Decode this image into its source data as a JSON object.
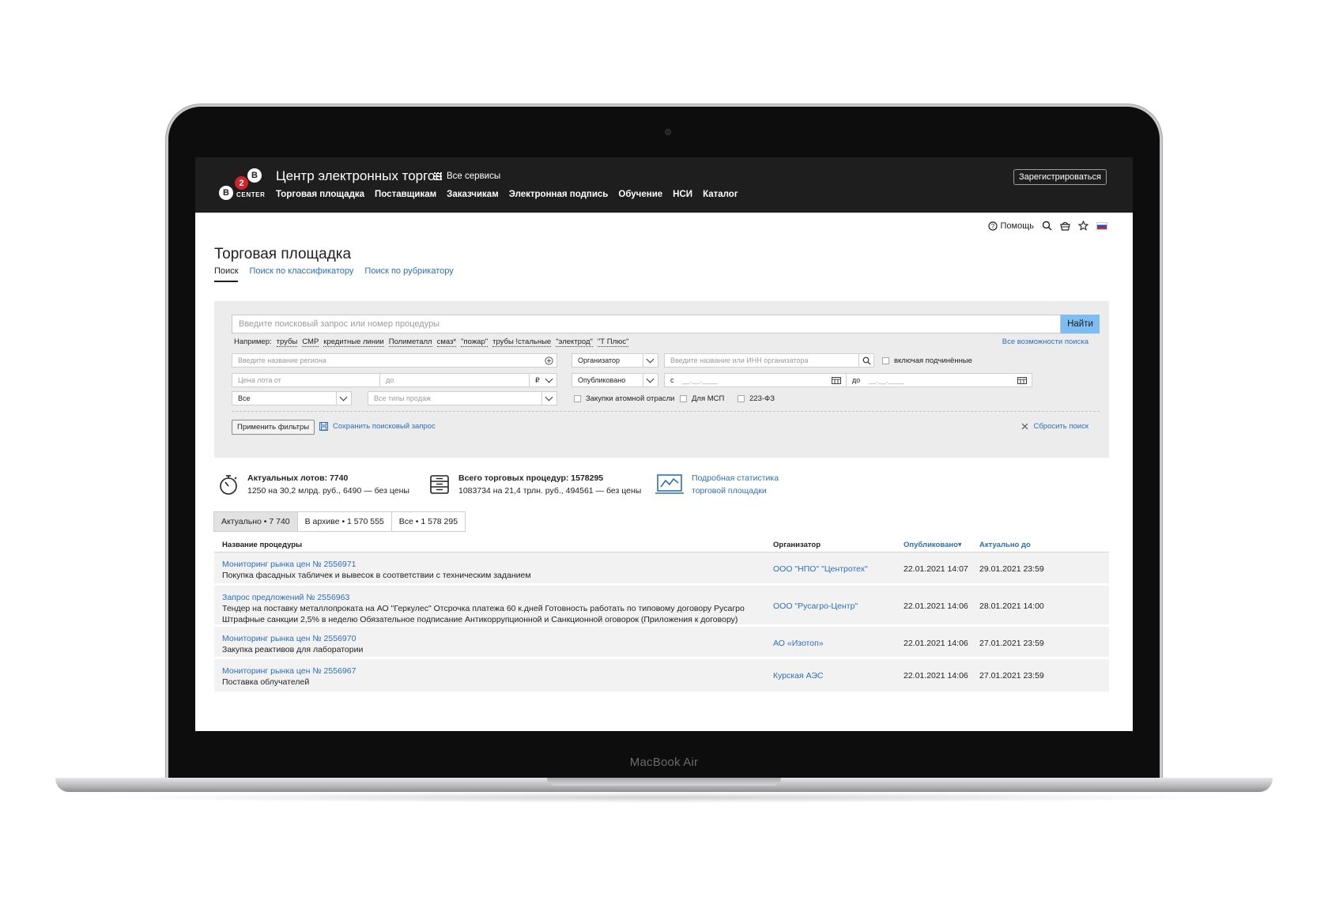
{
  "laptop": {
    "model_label": "MacBook Air"
  },
  "header": {
    "logo_letters": [
      "B",
      "2",
      "B"
    ],
    "logo_word": "CENTER",
    "site_title": "Центр электронных торгов",
    "all_services": "Все сервисы",
    "nav": [
      "Торговая площадка",
      "Поставщикам",
      "Заказчикам",
      "Электронная подпись",
      "Обучение",
      "НСИ",
      "Каталог"
    ],
    "register": "Зарегистрироваться"
  },
  "utility": {
    "help": "Помощь",
    "icons": [
      "help-icon",
      "search-icon",
      "basket-icon",
      "star-icon",
      "flag-ru-icon"
    ]
  },
  "page": {
    "title": "Торговая площадка",
    "tabs": [
      "Поиск",
      "Поиск по классификатору",
      "Поиск по рубрикатору"
    ]
  },
  "filters": {
    "search_placeholder": "Введите поисковый запрос или номер процедуры",
    "find": "Найти",
    "examples_label": "Например:",
    "examples": [
      "трубы",
      "СМР",
      "кредитные линии",
      "Полиметалл",
      "смаз*",
      "\"пожар\"",
      "трубы !стальные",
      "\"электрод\"",
      "\"Т Плюс\""
    ],
    "all_options": "Все возможности поиска",
    "region_placeholder": "Введите название региона",
    "organizer_select": "Организатор",
    "organizer_placeholder": "Введите название или ИНН организатора",
    "include_sub": "включая подчинённые",
    "price_from": "Цена лота от",
    "price_to": "до",
    "currency": "₽",
    "published_select": "Опубликовано",
    "date_from_label": "с",
    "date_from_mask": "__.__.____",
    "date_to_label": "до",
    "date_to_mask": "__.__.____",
    "all_select": "Все",
    "sale_types": "Все типы продаж",
    "checkbox_atomic": "Закупки атомной отрасли",
    "checkbox_msp": "Для МСП",
    "checkbox_223": "223-ФЗ",
    "apply": "Применить фильтры",
    "save_query": "Сохранить поисковый запрос",
    "reset": "Сбросить поиск"
  },
  "stats": {
    "lots_title": "Актуальных лотов: 7740",
    "lots_sub": "1250 на 30,2 млрд. руб., 6490 — без цены",
    "total_title": "Всего торговых процедур: 1578295",
    "total_sub": "1083734 на 21,4 трлн. руб., 494561 — без цены",
    "link_line1": "Подробная статистика",
    "link_line2": "торговой площадки"
  },
  "result_tabs": [
    "Актуально • 7 740",
    "В архиве • 1 570 555",
    "Все • 1 578 295"
  ],
  "table": {
    "columns": {
      "name": "Название процедуры",
      "organizer": "Организатор",
      "published": "Опубликовано",
      "published_sort_arrow": "▾",
      "actual_till": "Актуально до"
    },
    "rows": [
      {
        "link": "Мониторинг рынка цен № 2556971",
        "desc": "Покупка фасадных табличек и вывесок в соответствии с техническим заданием",
        "organizer": "ООО \"НПО\" \"Центротех\"",
        "published": "22.01.2021 14:07",
        "till": "29.01.2021 23:59"
      },
      {
        "link": "Запрос предложений № 2556963",
        "desc": "Тендер на поставку металлопроката на АО \"Геркулес\" Отсрочка платежа 60 к.дней Готовность работать по типовому договору Русагро Штрафные санкции 2,5% в неделю Обязательное подписание Антикоррупционной и Санкционной оговорок (Приложения к договору)",
        "organizer": "ООО \"Русагро-Центр\"",
        "published": "22.01.2021 14:06",
        "till": "28.01.2021 14:00"
      },
      {
        "link": "Мониторинг рынка цен № 2556970",
        "desc": "Закупка реактивов для лаборатории",
        "organizer": "АО «Изотоп»",
        "published": "22.01.2021 14:06",
        "till": "27.01.2021 23:59"
      },
      {
        "link": "Мониторинг рынка цен № 2556967",
        "desc": "Поставка облучателей",
        "organizer": "Курская АЭС",
        "published": "22.01.2021 14:06",
        "till": "27.01.2021 23:59"
      }
    ]
  }
}
